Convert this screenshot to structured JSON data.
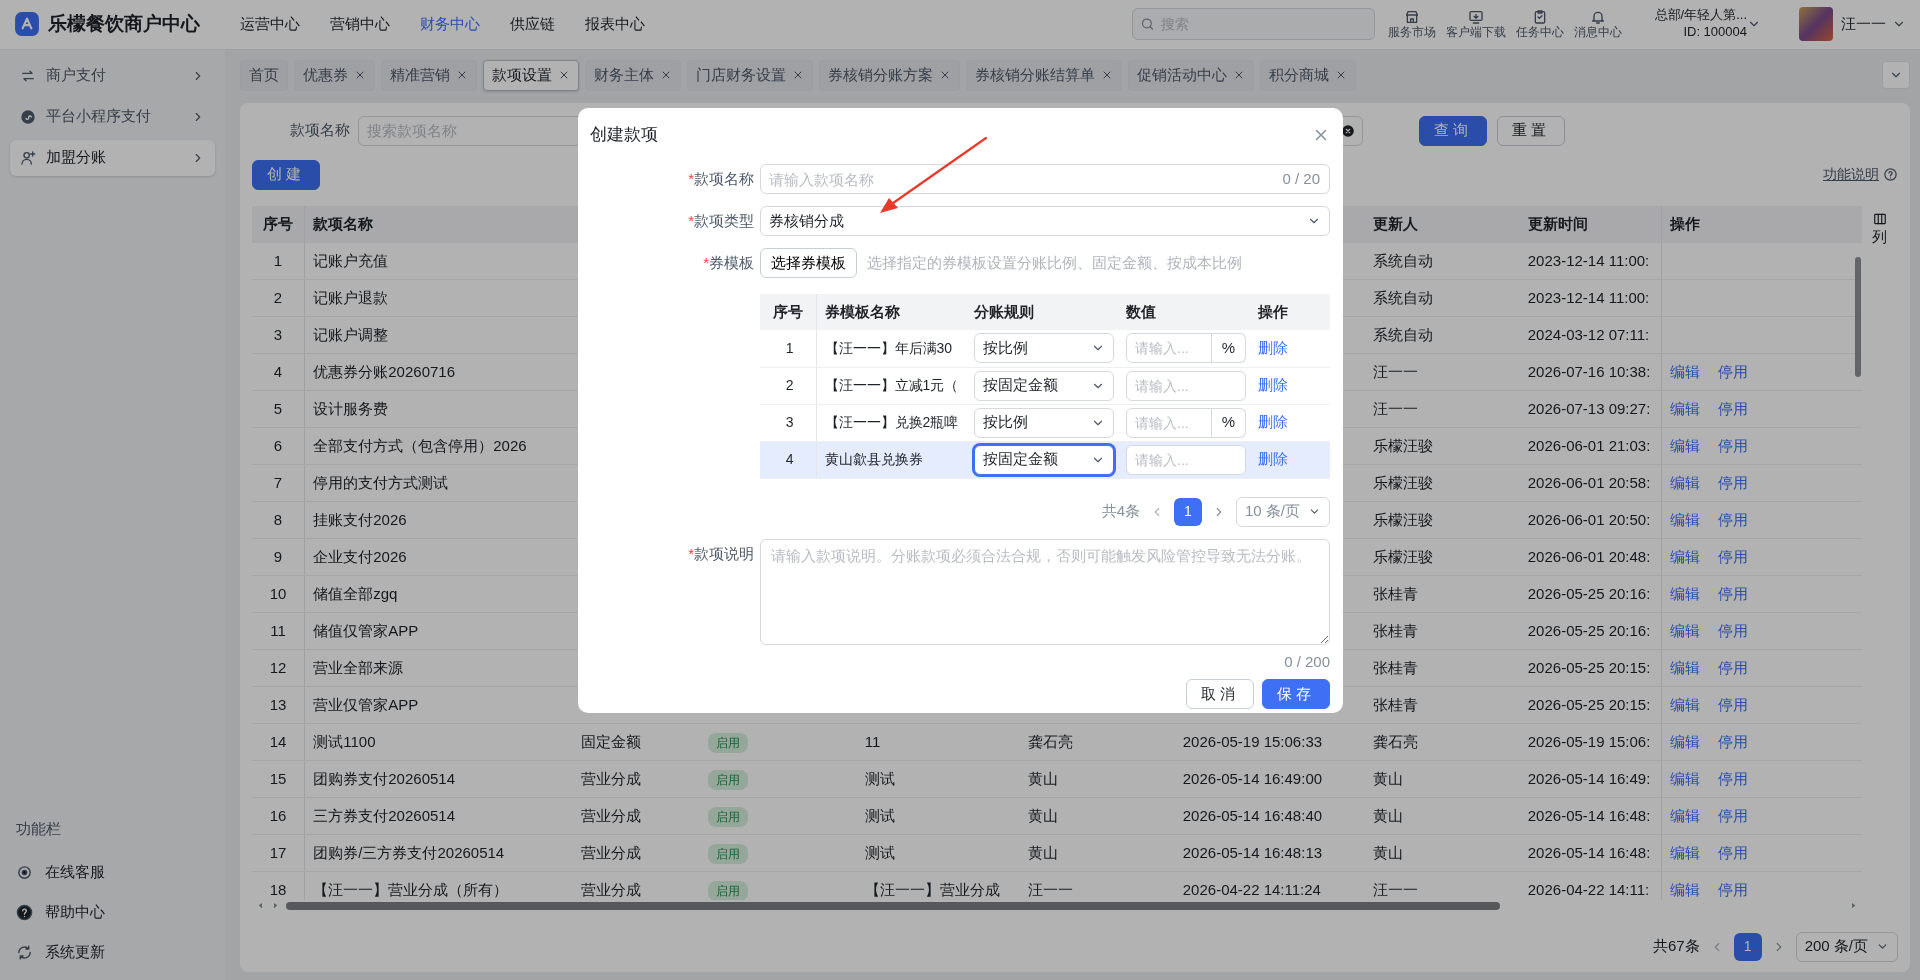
{
  "header": {
    "logo_text": "乐檬餐饮商户中心",
    "nav": [
      {
        "label": "运营中心",
        "selected": false
      },
      {
        "label": "营销中心",
        "selected": false
      },
      {
        "label": "财务中心",
        "selected": true
      },
      {
        "label": "供应链",
        "selected": false
      },
      {
        "label": "报表中心",
        "selected": false
      }
    ],
    "search": {
      "placeholder": "搜索"
    },
    "tools": [
      "服务市场",
      "客户端下载",
      "任务中心",
      "消息中心"
    ],
    "account": {
      "org": "总部/年轻人第...",
      "id": "ID: 100004"
    },
    "user": {
      "name": "汪一一"
    }
  },
  "sidebar": {
    "items": [
      {
        "label": "商户支付",
        "selected": false
      },
      {
        "label": "平台小程序支付",
        "selected": false
      },
      {
        "label": "加盟分账",
        "selected": true
      }
    ],
    "section_title": "功能栏",
    "footer_items": [
      "在线客服",
      "帮助中心",
      "系统更新"
    ]
  },
  "tabs": [
    {
      "label": "首页",
      "closable": false,
      "selected": false
    },
    {
      "label": "优惠券",
      "closable": true,
      "selected": false
    },
    {
      "label": "精准营销",
      "closable": true,
      "selected": false
    },
    {
      "label": "款项设置",
      "closable": true,
      "selected": true
    },
    {
      "label": "财务主体",
      "closable": true,
      "selected": false
    },
    {
      "label": "门店财务设置",
      "closable": true,
      "selected": false
    },
    {
      "label": "券核销分账方案",
      "closable": true,
      "selected": false
    },
    {
      "label": "券核销分账结算单",
      "closable": true,
      "selected": false
    },
    {
      "label": "促销活动中心",
      "closable": true,
      "selected": false
    },
    {
      "label": "积分商城",
      "closable": true,
      "selected": false
    }
  ],
  "filter": {
    "label": "款项名称",
    "placeholder": "搜索款项名称",
    "buttons": [
      {
        "label": "查询",
        "kind": "primary"
      },
      {
        "label": "重置",
        "kind": "default"
      }
    ]
  },
  "create_button": "创建",
  "help_link": "功能说明",
  "table": {
    "columns": [
      "序号",
      "款项名称",
      "更新人",
      "更新时间",
      "操作"
    ],
    "column_settings": "列",
    "rows": [
      {
        "seq": "1",
        "name": "记账户充值",
        "updater": "系统自动",
        "updated_at": "2023-12-14 11:00:",
        "actions": []
      },
      {
        "seq": "2",
        "name": "记账户退款",
        "updater": "系统自动",
        "updated_at": "2023-12-14 11:00:",
        "actions": []
      },
      {
        "seq": "3",
        "name": "记账户调整",
        "updater": "系统自动",
        "updated_at": "2024-03-12 07:11:",
        "actions": []
      },
      {
        "seq": "4",
        "name": "优惠券分账20260716",
        "updater": "汪一一",
        "updated_at": "2026-07-16 10:38:",
        "actions": [
          "编辑",
          "停用"
        ]
      },
      {
        "seq": "5",
        "name": "设计服务费",
        "updater": "汪一一",
        "updated_at": "2026-07-13 09:27:",
        "actions": [
          "编辑",
          "停用"
        ]
      },
      {
        "seq": "6",
        "name": "全部支付方式（包含停用）2026",
        "updater": "乐檬汪骏",
        "updated_at": "2026-06-01 21:03:",
        "actions": [
          "编辑",
          "停用"
        ]
      },
      {
        "seq": "7",
        "name": "停用的支付方式测试",
        "updater": "乐檬汪骏",
        "updated_at": "2026-06-01 20:58:",
        "actions": [
          "编辑",
          "停用"
        ]
      },
      {
        "seq": "8",
        "name": "挂账支付2026",
        "updater": "乐檬汪骏",
        "updated_at": "2026-06-01 20:50:",
        "actions": [
          "编辑",
          "停用"
        ]
      },
      {
        "seq": "9",
        "name": "企业支付2026",
        "updater": "乐檬汪骏",
        "updated_at": "2026-06-01 20:48:",
        "actions": [
          "编辑",
          "停用"
        ]
      },
      {
        "seq": "10",
        "name": "储值全部zgq",
        "updater": "张桂青",
        "updated_at": "2026-05-25 20:16:",
        "actions": [
          "编辑",
          "停用"
        ]
      },
      {
        "seq": "11",
        "name": "储值仅管家APP",
        "updater": "张桂青",
        "updated_at": "2026-05-25 20:16:",
        "actions": [
          "编辑",
          "停用"
        ]
      },
      {
        "seq": "12",
        "name": "营业全部来源",
        "updater": "张桂青",
        "updated_at": "2026-05-25 20:15:",
        "actions": [
          "编辑",
          "停用"
        ]
      },
      {
        "seq": "13",
        "name": "营业仅管家APP",
        "updater": "张桂青",
        "updated_at": "2026-05-25 20:15:",
        "actions": [
          "编辑",
          "停用"
        ]
      },
      {
        "seq": "14",
        "name": "测试1100",
        "column_3": "固定金额",
        "column_4": "启用",
        "column_5": "11",
        "column_6": "龚石亮",
        "column_7": "2026-05-19 15:06:33",
        "updater": "龚石亮",
        "updated_at": "2026-05-19 15:06:",
        "actions": [
          "编辑",
          "停用"
        ]
      },
      {
        "seq": "15",
        "name": "团购券支付20260514",
        "column_3": "营业分成",
        "column_4": "启用",
        "column_5": "测试",
        "column_6": "黄山",
        "column_7": "2026-05-14 16:49:00",
        "updater": "黄山",
        "updated_at": "2026-05-14 16:49:",
        "actions": [
          "编辑",
          "停用"
        ]
      },
      {
        "seq": "16",
        "name": "三方券支付20260514",
        "column_3": "营业分成",
        "column_4": "启用",
        "column_5": "测试",
        "column_6": "黄山",
        "column_7": "2026-05-14 16:48:40",
        "updater": "黄山",
        "updated_at": "2026-05-14 16:48:",
        "actions": [
          "编辑",
          "停用"
        ]
      },
      {
        "seq": "17",
        "name": "团购券/三方券支付20260514",
        "column_3": "营业分成",
        "column_4": "启用",
        "column_5": "测试",
        "column_6": "黄山",
        "column_7": "2026-05-14 16:48:13",
        "updater": "黄山",
        "updated_at": "2026-05-14 16:48:",
        "actions": [
          "编辑",
          "停用"
        ]
      },
      {
        "seq": "18",
        "name": "【汪一一】营业分成（所有）",
        "column_3": "营业分成",
        "column_4": "启用",
        "column_5": "【汪一一】营业分成",
        "column_6": "汪一一",
        "column_7": "2026-04-22 14:11:24",
        "updater": "汪一一",
        "updated_at": "2026-04-22 14:11:",
        "actions": [
          "编辑",
          "停用"
        ]
      }
    ]
  },
  "pagination": {
    "total": "共67条",
    "pages": [
      {
        "label": "1",
        "selected": true
      }
    ],
    "page_size": "200 条/页"
  },
  "dialog": {
    "title": "创建款项",
    "fields": [
      {
        "kind": "text",
        "label": "款项名称",
        "required_mark": "*",
        "placeholder": "请输入款项名称",
        "counter": "0 / 20"
      },
      {
        "kind": "select",
        "label": "款项类型",
        "required_mark": "*",
        "value": "券核销分成"
      },
      {
        "kind": "picker",
        "label": "券模板",
        "required_mark": "*",
        "button": "选择券模板",
        "hint": "选择指定的券模板设置分账比例、固定金额、按成本比例",
        "table": {
          "columns": [
            "序号",
            "券模板名称",
            "分账规则",
            "数值",
            "操作"
          ],
          "rows": [
            {
              "seq": "1",
              "name": "【汪一一】年后满30",
              "rule": "按比例",
              "value_placeholder": "请输入...",
              "unit": "%",
              "action": "删除",
              "selected": false
            },
            {
              "seq": "2",
              "name": "【汪一一】立减1元（",
              "rule": "按固定金额",
              "value_placeholder": "请输入...",
              "action": "删除",
              "selected": false
            },
            {
              "seq": "3",
              "name": "【汪一一】兑换2瓶啤",
              "rule": "按比例",
              "value_placeholder": "请输入...",
              "unit": "%",
              "action": "删除",
              "selected": false
            },
            {
              "seq": "4",
              "name": "黄山歙县兑换券",
              "rule": "按固定金额",
              "value_placeholder": "请输入...",
              "action": "删除",
              "selected": true
            }
          ]
        },
        "pagination": {
          "total": "共4条",
          "pages": [
            {
              "label": "1",
              "selected": true
            }
          ],
          "page_size": "10 条/页"
        }
      },
      {
        "kind": "textarea",
        "label": "款项说明",
        "required_mark": "*",
        "placeholder": "请输入款项说明。分账款项必须合法合规，否则可能触发风险管控导致无法分账。",
        "counter": "0 / 200"
      }
    ],
    "buttons": [
      {
        "label": "取消",
        "kind": "default"
      },
      {
        "label": "保存",
        "kind": "primary"
      }
    ]
  }
}
